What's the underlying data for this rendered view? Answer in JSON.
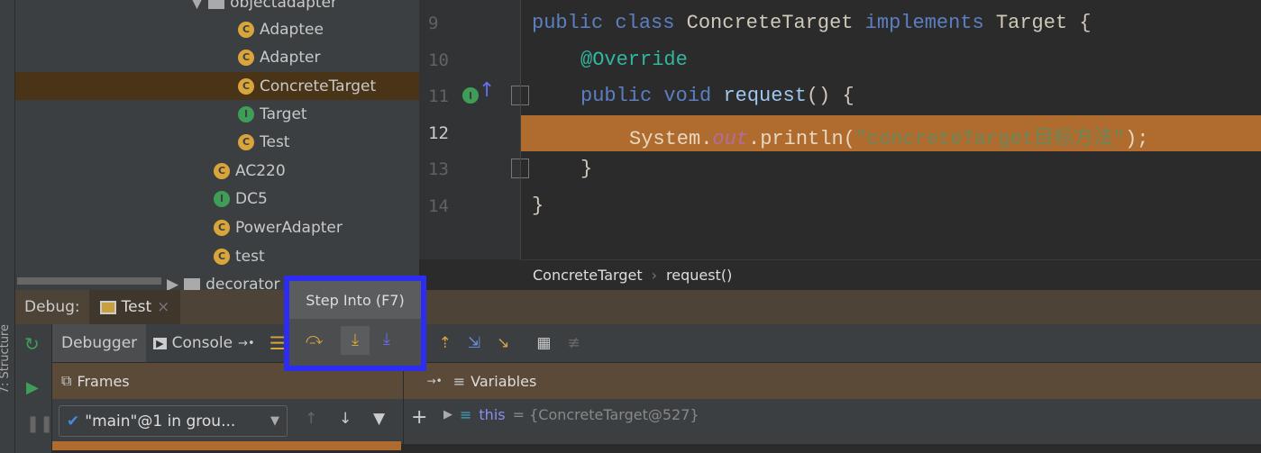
{
  "project_tree": {
    "items": [
      {
        "label": "objectadapter",
        "type": "package"
      },
      {
        "label": "Adaptee",
        "type": "class"
      },
      {
        "label": "Adapter",
        "type": "class"
      },
      {
        "label": "ConcreteTarget",
        "type": "class",
        "selected": true
      },
      {
        "label": "Target",
        "type": "interface"
      },
      {
        "label": "Test",
        "type": "class-main"
      },
      {
        "label": "AC220",
        "type": "class"
      },
      {
        "label": "DC5",
        "type": "interface"
      },
      {
        "label": "PowerAdapter",
        "type": "class"
      },
      {
        "label": "test",
        "type": "class-main"
      },
      {
        "label": "decorator",
        "type": "package"
      }
    ]
  },
  "editor": {
    "line_numbers": [
      "9",
      "10",
      "11",
      "12",
      "13",
      "14"
    ],
    "current_line": "12",
    "breadcrumb": [
      "ConcreteTarget",
      "request()"
    ],
    "code": {
      "l9": [
        "public class ",
        "ConcreteTarget",
        " implements ",
        "Target",
        " {"
      ],
      "l10": "@Override",
      "l11": [
        "public void ",
        "request",
        "() {"
      ],
      "l12": [
        "System.",
        "out",
        ".println(",
        "\"concreteTarget目标方法\"",
        ");"
      ],
      "l13": "}",
      "l14": "}"
    }
  },
  "debug": {
    "label": "Debug:",
    "session_tab": "Test",
    "tabs": [
      "Debugger",
      "Console"
    ],
    "tooltip": "Step Into (F7)",
    "frames_label": "Frames",
    "variables_label": "Variables",
    "thread_select": "\"main\"@1 in grou...",
    "variable": {
      "name": "this",
      "value": "= {ConcreteTarget@527}"
    },
    "side_label": "7: Structure"
  },
  "colors": {
    "highlight": "#b06c2f",
    "tooltip_border": "#2c2cf5",
    "selected_row": "#4a3417"
  }
}
